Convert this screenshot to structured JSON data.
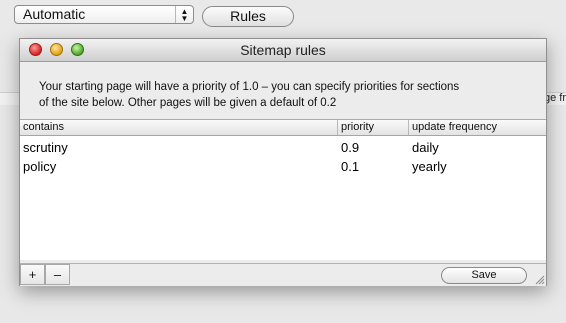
{
  "background": {
    "select_value": "Automatic",
    "rules_button_label": "Rules",
    "clipped_text": "ge fr"
  },
  "dialog": {
    "title": "Sitemap rules",
    "info_line1": "Your starting page will have a priority of 1.0 – you can specify priorities for sections",
    "info_line2": "of the site below. Other pages will be given a default of 0.2",
    "table": {
      "headers": [
        "contains",
        "priority",
        "update frequency"
      ],
      "rows": [
        {
          "contains": "scrutiny",
          "priority": "0.9",
          "frequency": "daily"
        },
        {
          "contains": "policy",
          "priority": "0.1",
          "frequency": "yearly"
        }
      ]
    },
    "add_label": "+",
    "remove_label": "–",
    "save_label": "Save"
  }
}
